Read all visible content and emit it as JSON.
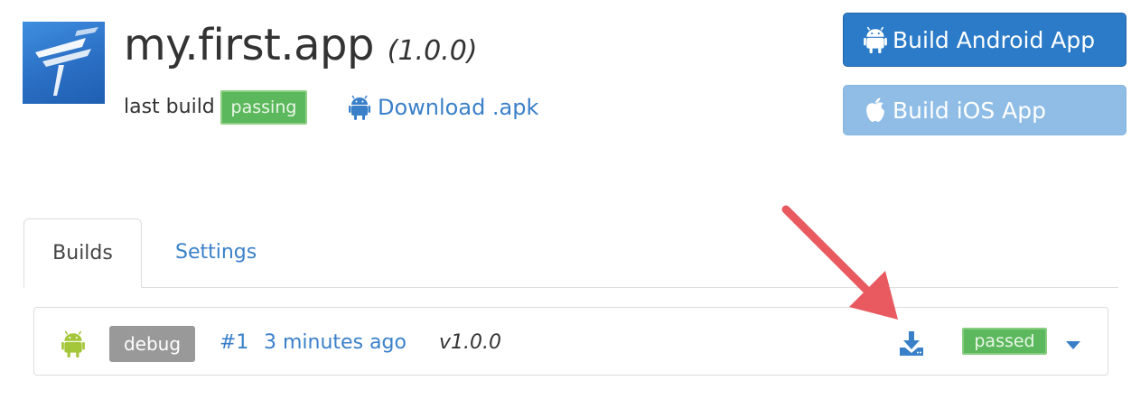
{
  "app": {
    "name": "my.first.app",
    "version": "(1.0.0)",
    "last_build_label": "last build",
    "status_badge": "passing",
    "download_link": "Download .apk"
  },
  "actions": {
    "build_android": "Build Android App",
    "build_ios": "Build iOS App"
  },
  "tabs": [
    {
      "label": "Builds",
      "active": true
    },
    {
      "label": "Settings",
      "active": false
    }
  ],
  "builds": [
    {
      "platform_icon": "android-icon",
      "type": "debug",
      "number": "#1",
      "time": "3 minutes ago",
      "version": "v1.0.0",
      "status": "passed"
    }
  ],
  "colors": {
    "primary": "#2b7bc8",
    "primary_light": "#8fbde6",
    "link": "#3a80c9",
    "success": "#5cb85c",
    "android_green": "#a4c639",
    "annotation_arrow": "#e85a60"
  }
}
